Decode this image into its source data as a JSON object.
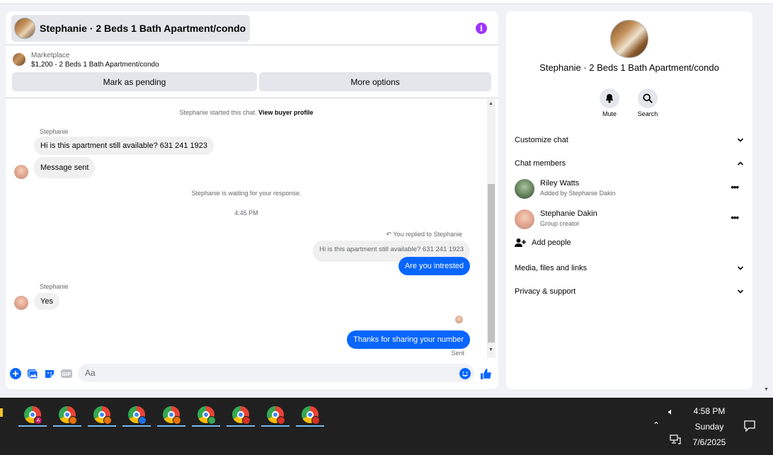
{
  "chat": {
    "title": "Stephanie · 2 Beds 1 Bath Apartment/condo",
    "marketplace_label": "Marketplace",
    "listing": "$1,200 - 2 Beds 1 Bath Apartment/condo",
    "mark_pending": "Mark as pending",
    "more_options": "More options",
    "started_prefix": "Stephanie started this chat.",
    "view_profile": "View buyer profile",
    "sender1": "Stephanie",
    "msg1": "Hi is this apartment still available? 631 241 1923",
    "msg2": "Message sent",
    "waiting": "Stephanie is waiting for your response.",
    "time": "4:45 PM",
    "replied_note": "You replied to Stephanie",
    "quoted": "Hi is this apartment still available? 631 241 1923",
    "reply": "Are you intrested",
    "sender2": "Stephanie",
    "msg3": "Yes",
    "msg4": "Thanks for sharing your number",
    "sent": "Sent",
    "input_placeholder": "Aa"
  },
  "side": {
    "title": "Stephanie · 2 Beds 1 Bath Apartment/condo",
    "mute": "Mute",
    "search": "Search",
    "customize": "Customize chat",
    "members_header": "Chat members",
    "members": [
      {
        "name": "Riley Watts",
        "role": "Added by Stephanie Dakin"
      },
      {
        "name": "Stephanie Dakin",
        "role": "Group creator"
      }
    ],
    "add_people": "Add people",
    "media": "Media, files and links",
    "privacy": "Privacy & support"
  },
  "taskbar": {
    "time": "4:58 PM",
    "day": "Sunday",
    "date": "7/6/2025",
    "badge_letter": "A"
  },
  "colors": {
    "accent": "#0866ff",
    "info": "#a033ff",
    "taskbar": "#202020"
  }
}
